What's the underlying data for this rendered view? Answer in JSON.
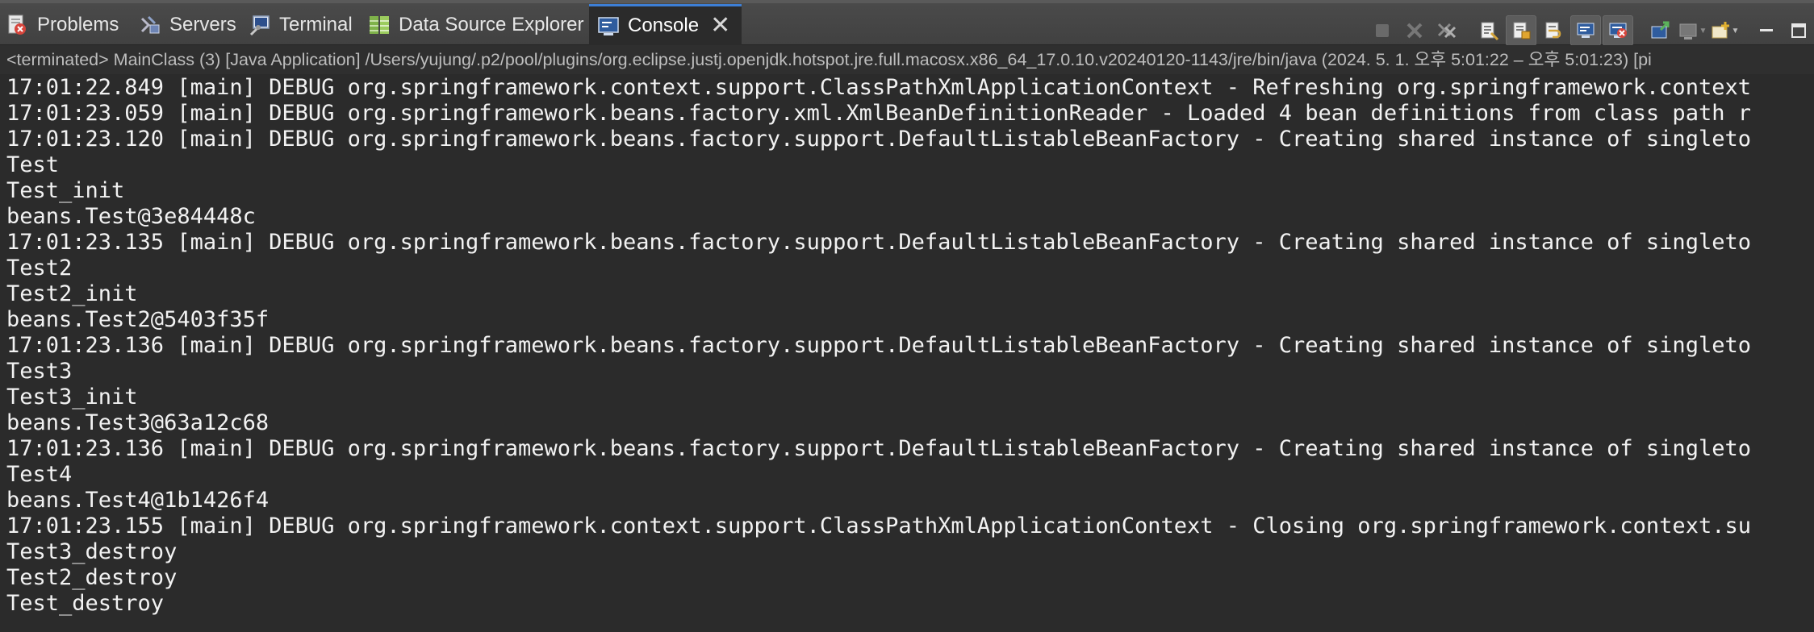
{
  "tabs": [
    {
      "label": "Problems",
      "icon": "problems-icon",
      "active": false
    },
    {
      "label": "Servers",
      "icon": "servers-icon",
      "active": false
    },
    {
      "label": "Terminal",
      "icon": "terminal-icon",
      "active": false
    },
    {
      "label": "Data Source Explorer",
      "icon": "database-icon",
      "active": false
    },
    {
      "label": "Console",
      "icon": "console-icon",
      "active": true
    }
  ],
  "toolbar_icons": [
    "terminate-icon",
    "remove-launch-icon",
    "remove-all-terminated-icon",
    "clear-console-icon",
    "scroll-lock-icon",
    "word-wrap-icon",
    "show-on-stdout-icon",
    "show-on-stderr-icon",
    "pin-console-icon",
    "display-selected-console-icon",
    "open-console-icon",
    "minimize-icon",
    "maximize-icon"
  ],
  "status": "<terminated> MainClass (3) [Java Application] /Users/yujung/.p2/pool/plugins/org.eclipse.justj.openjdk.hotspot.jre.full.macosx.x86_64_17.0.10.v20240120-1143/jre/bin/java  (2024. 5. 1. 오후 5:01:22 – 오후 5:01:23) [pi",
  "console_lines": [
    "17:01:22.849 [main] DEBUG org.springframework.context.support.ClassPathXmlApplicationContext - Refreshing org.springframework.context",
    "17:01:23.059 [main] DEBUG org.springframework.beans.factory.xml.XmlBeanDefinitionReader - Loaded 4 bean definitions from class path r",
    "17:01:23.120 [main] DEBUG org.springframework.beans.factory.support.DefaultListableBeanFactory - Creating shared instance of singleto",
    "Test",
    "Test_init",
    "beans.Test@3e84448c",
    "17:01:23.135 [main] DEBUG org.springframework.beans.factory.support.DefaultListableBeanFactory - Creating shared instance of singleto",
    "Test2",
    "Test2_init",
    "beans.Test2@5403f35f",
    "17:01:23.136 [main] DEBUG org.springframework.beans.factory.support.DefaultListableBeanFactory - Creating shared instance of singleto",
    "Test3",
    "Test3_init",
    "beans.Test3@63a12c68",
    "17:01:23.136 [main] DEBUG org.springframework.beans.factory.support.DefaultListableBeanFactory - Creating shared instance of singleto",
    "Test4",
    "beans.Test4@1b1426f4",
    "17:01:23.155 [main] DEBUG org.springframework.context.support.ClassPathXmlApplicationContext - Closing org.springframework.context.su",
    "Test3_destroy",
    "Test2_destroy",
    "Test_destroy"
  ]
}
